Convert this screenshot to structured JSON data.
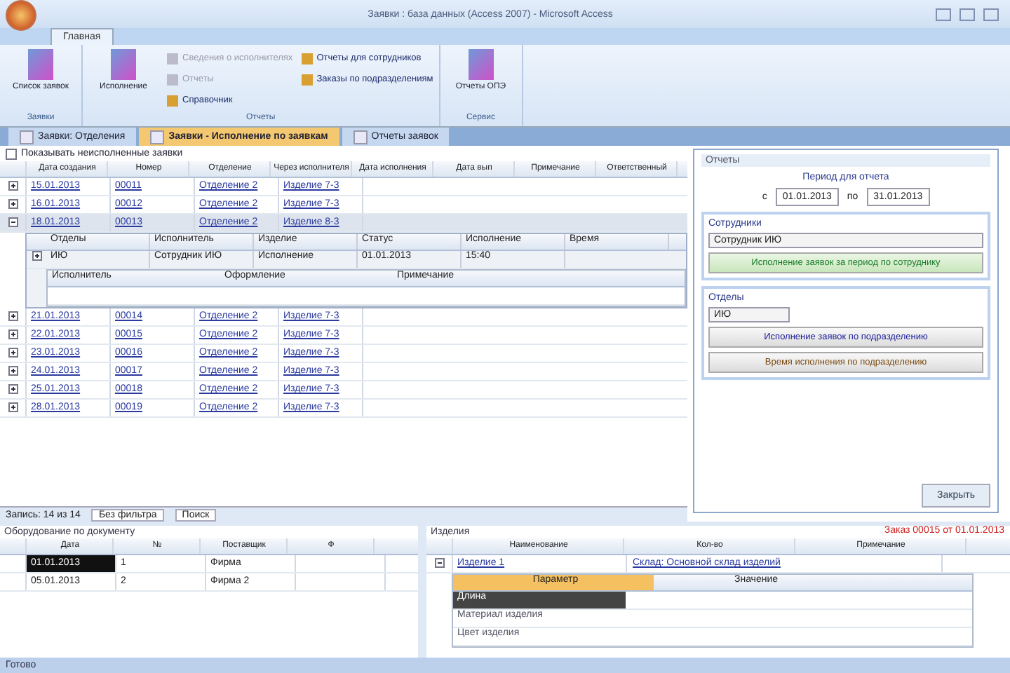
{
  "window": {
    "title": "Заявки : база данных (Access 2007) - Microsoft Access"
  },
  "ribbon": {
    "tabs": [
      {
        "label": "Главная",
        "selected": true
      }
    ],
    "groups": [
      {
        "label": "Заявки",
        "items": [
          {
            "kind": "big",
            "label": "Список заявок",
            "disabled": false
          }
        ]
      },
      {
        "label": "Отчеты",
        "items": [
          {
            "kind": "big",
            "label": "Исполнение",
            "disabled": false
          },
          {
            "kind": "small",
            "label": "Сведения о исполнителях",
            "disabled": true
          },
          {
            "kind": "small",
            "label": "Отчеты",
            "disabled": true
          },
          {
            "kind": "small",
            "label": "Справочник",
            "disabled": false
          },
          {
            "kind": "small",
            "label": "Отчеты для сотрудников",
            "disabled": false
          },
          {
            "kind": "small",
            "label": "Заказы по подразделениям",
            "disabled": false
          }
        ]
      },
      {
        "label": "Сервис",
        "items": [
          {
            "kind": "big",
            "label": "Отчеты ОПЭ",
            "disabled": false
          }
        ]
      }
    ]
  },
  "doc_tabs": [
    {
      "label": "Заявки: Отделения",
      "selected": false
    },
    {
      "label": "Заявки - Исполнение по заявкам",
      "selected": true
    },
    {
      "label": "Отчеты заявок",
      "selected": false
    }
  ],
  "filter": {
    "label": "Показывать неисполненные заявки",
    "checked": false
  },
  "table": {
    "columns": [
      "Дата создания",
      "Номер",
      "Отделение",
      "Через исполнителя",
      "Дата исполнения",
      "Дата вып",
      "Примечание",
      "Ответственный"
    ],
    "rows": [
      {
        "cells": [
          "15.01.2013",
          "00011",
          "Отделение 2",
          "Изделие 7-3"
        ],
        "expanded": false
      },
      {
        "cells": [
          "16.01.2013",
          "00012",
          "Отделение 2",
          "Изделие 7-3"
        ],
        "expanded": false
      },
      {
        "cells": [
          "18.01.2013",
          "00013",
          "Отделение 2",
          "Изделие 8-3"
        ],
        "expanded": true,
        "sub": {
          "columns": [
            "Отделы",
            "Исполнитель",
            "Изделие",
            "Статус",
            "Исполнение",
            "Время"
          ],
          "cells": [
            "ИЮ",
            "Сотрудник ИЮ",
            "Исполнение",
            "01.01.2013",
            "15:40"
          ],
          "sub_columns": [
            "Исполнитель",
            "Оформление",
            "Примечание"
          ]
        }
      },
      {
        "cells": [
          "21.01.2013",
          "00014",
          "Отделение 2",
          "Изделие 7-3"
        ],
        "expanded": false
      },
      {
        "cells": [
          "22.01.2013",
          "00015",
          "Отделение 2",
          "Изделие 7-3"
        ],
        "expanded": false
      },
      {
        "cells": [
          "23.01.2013",
          "00016",
          "Отделение 2",
          "Изделие 7-3"
        ],
        "expanded": false
      },
      {
        "cells": [
          "24.01.2013",
          "00017",
          "Отделение 2",
          "Изделие 7-3"
        ],
        "expanded": false
      },
      {
        "cells": [
          "25.01.2013",
          "00018",
          "Отделение 2",
          "Изделие 7-3"
        ],
        "expanded": false
      },
      {
        "cells": [
          "28.01.2013",
          "00019",
          "Отделение 2",
          "Изделие 7-3"
        ],
        "expanded": false
      }
    ]
  },
  "reports": {
    "title": "Отчеты",
    "period_label": "Период для отчета",
    "from_label": "с",
    "from": "01.01.2013",
    "to_label": "по",
    "to": "31.01.2013",
    "staff": {
      "label": "Сотрудники",
      "value": "Сотрудник ИЮ",
      "button": "Исполнение заявок за период по сотруднику"
    },
    "depts": {
      "label": "Отделы",
      "value": "ИЮ",
      "buttons": [
        {
          "label": "Исполнение заявок по подразделению",
          "color": "#1a1a9a"
        },
        {
          "label": "Время исполнения по подразделению",
          "color": "#7a4a10"
        }
      ]
    },
    "close": "Закрыть"
  },
  "nav": {
    "record": "Запись: 14 из 14",
    "filter": "Без фильтра",
    "search": "Поиск"
  },
  "docs": {
    "title": "Оборудование по документу",
    "columns": [
      "Дата",
      "№",
      "Поставщик",
      "Ф"
    ],
    "rows": [
      {
        "cells": [
          "01.01.2013",
          "1",
          "Фирма",
          ""
        ],
        "selected": true
      },
      {
        "cells": [
          "05.01.2013",
          "2",
          "Фирма 2",
          ""
        ],
        "selected": false
      }
    ]
  },
  "items": {
    "title": "Изделия",
    "note": "Заказ 00015 от 01.01.2013",
    "columns": [
      "Наименование",
      "Кол-во",
      "Примечание"
    ],
    "group": {
      "name": "Изделие 1",
      "info": "Склад: Основной склад изделий"
    },
    "params": {
      "columns": [
        "Параметр",
        "Значение"
      ],
      "value": "Длина",
      "rows": [
        "Материал изделия",
        "Цвет изделия"
      ]
    }
  },
  "status": "Готово"
}
